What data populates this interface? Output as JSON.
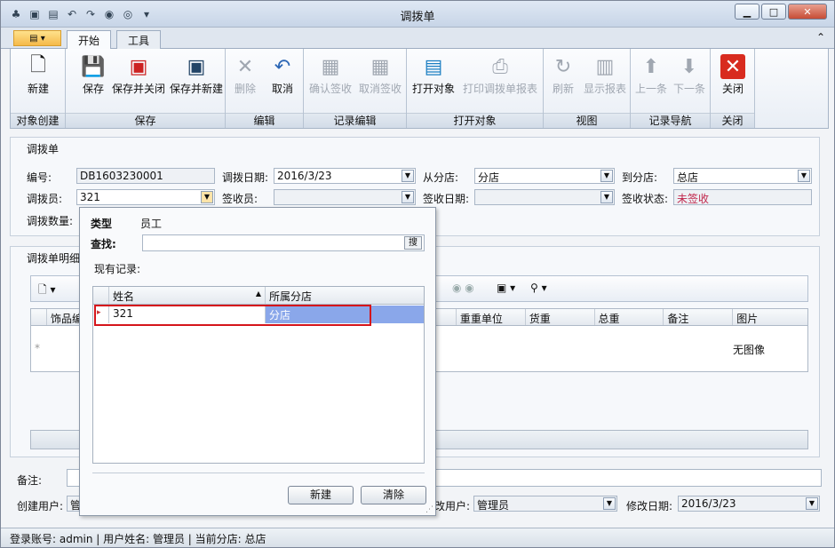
{
  "window": {
    "title": "调拨单",
    "qat_chevron": "▾"
  },
  "tabs": [
    "开始",
    "工具"
  ],
  "ribbon": {
    "groups": [
      {
        "label": "对象创建",
        "buttons": [
          {
            "label": "新建",
            "icon": "new-doc-icon",
            "enabled": true
          }
        ]
      },
      {
        "label": "保存",
        "buttons": [
          {
            "label": "保存",
            "icon": "save-icon",
            "enabled": true
          },
          {
            "label": "保存并关闭",
            "icon": "save-close-icon",
            "enabled": true
          },
          {
            "label": "保存并新建",
            "icon": "save-new-icon",
            "enabled": true
          }
        ]
      },
      {
        "label": "编辑",
        "buttons": [
          {
            "label": "删除",
            "icon": "delete-icon",
            "enabled": false
          },
          {
            "label": "取消",
            "icon": "undo-icon",
            "enabled": true
          }
        ]
      },
      {
        "label": "记录编辑",
        "buttons": [
          {
            "label": "确认签收",
            "icon": "confirm-icon",
            "enabled": false
          },
          {
            "label": "取消签收",
            "icon": "cancel-sign-icon",
            "enabled": false
          }
        ]
      },
      {
        "label": "打开对象",
        "buttons": [
          {
            "label": "打开对象",
            "icon": "open-object-icon",
            "enabled": true
          },
          {
            "label": "打印调拨单报表",
            "icon": "printer-icon",
            "enabled": false
          }
        ]
      },
      {
        "label": "视图",
        "buttons": [
          {
            "label": "刷新",
            "icon": "refresh-icon",
            "enabled": false
          },
          {
            "label": "显示报表",
            "icon": "report-icon",
            "enabled": false
          }
        ]
      },
      {
        "label": "记录导航",
        "buttons": [
          {
            "label": "上一条",
            "icon": "arrow-up-icon",
            "enabled": false
          },
          {
            "label": "下一条",
            "icon": "arrow-down-icon",
            "enabled": false
          }
        ]
      },
      {
        "label": "关闭",
        "buttons": [
          {
            "label": "关闭",
            "icon": "close-icon",
            "enabled": true
          }
        ]
      }
    ]
  },
  "form": {
    "section_title": "调拨单",
    "number_label": "编号:",
    "number": "DB1603230001",
    "date_label": "调拨日期:",
    "date": "2016/3/23",
    "from_label": "从分店:",
    "from": "分店",
    "to_label": "到分店:",
    "to": "总店",
    "transfer_person_label": "调拨员:",
    "transfer_person": "321",
    "receiver_label": "签收员:",
    "receiver": "",
    "sign_date_label": "签收日期:",
    "sign_date": "",
    "sign_status_label": "签收状态:",
    "sign_status": "未签收",
    "quantity_label": "调拨数量:"
  },
  "detail": {
    "section_title": "调拨单明细",
    "columns": [
      "饰品编",
      "重重单位",
      "货重",
      "总重",
      "备注",
      "图片"
    ],
    "no_image": "无图像"
  },
  "footer": {
    "remark_label": "备注:",
    "creator_label": "创建用户:",
    "creator": "管",
    "modifier_label": "修改用户:",
    "modifier_visible": "改用户:",
    "modifier": "管理员",
    "modify_date_label": "修改日期:",
    "modify_date": "2016/3/23"
  },
  "popup": {
    "type_label": "类型",
    "type_value": "员工",
    "find_label": "查找:",
    "find_button": "搜",
    "records_label": "现有记录:",
    "columns": [
      "姓名",
      "所属分店"
    ],
    "rows": [
      {
        "name": "321",
        "branch": "分店"
      }
    ],
    "new_button": "新建",
    "clear_button": "清除"
  },
  "statusbar": {
    "text": "登录账号: admin | 用户姓名: 管理员 | 当前分店: 总店"
  },
  "colors": {
    "accent": "#d5151b",
    "selection": "#8aa7ea"
  }
}
